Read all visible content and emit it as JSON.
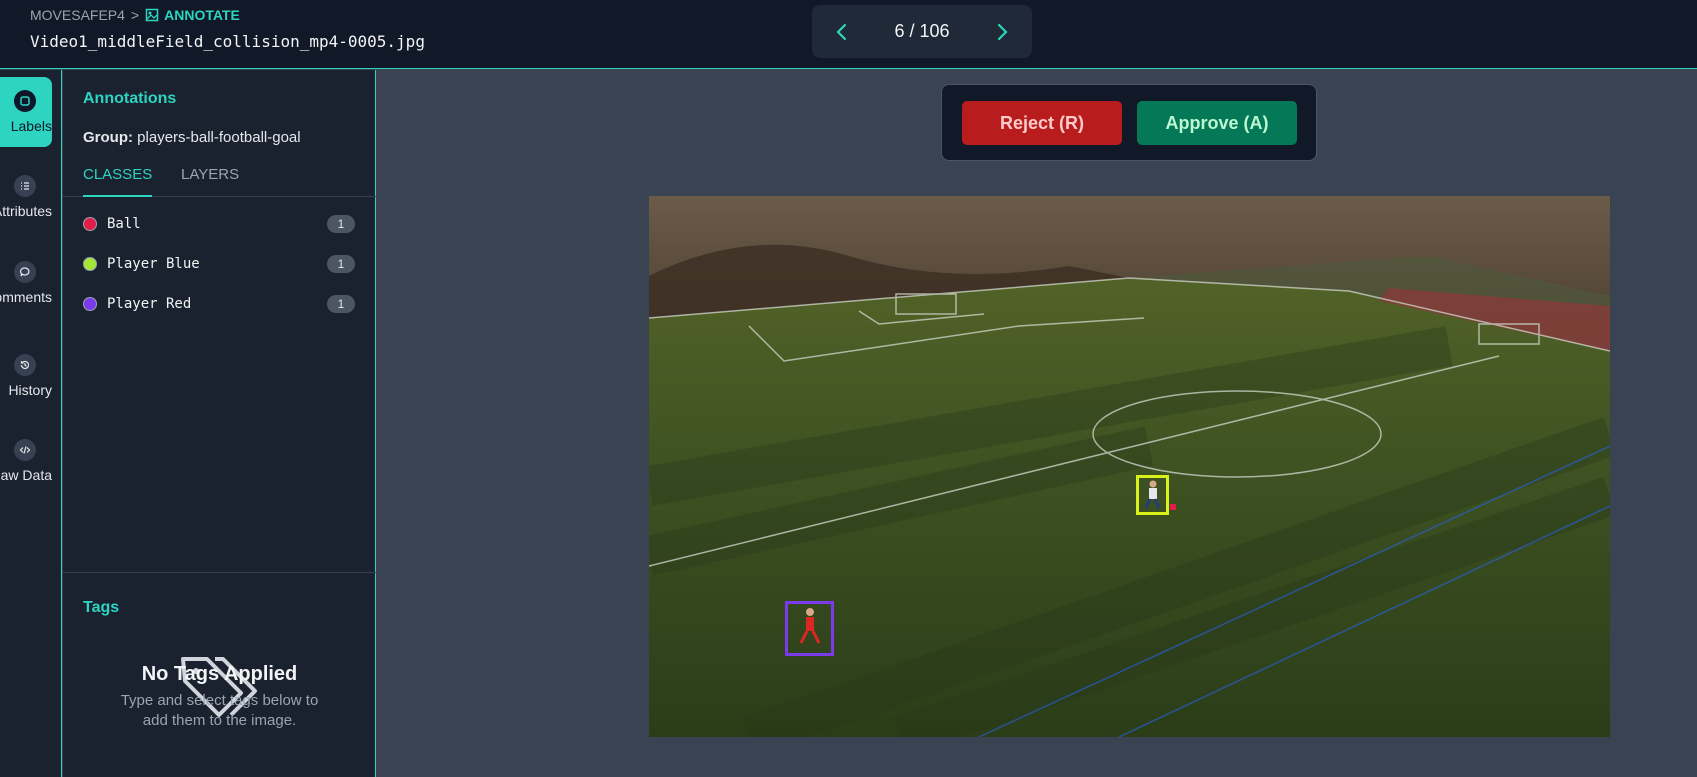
{
  "breadcrumb": {
    "project": "MOVESAFEP4",
    "separator": ">",
    "current": "ANNOTATE"
  },
  "filename": "Video1_middleField_collision_mp4-0005.jpg",
  "pager": {
    "label": "6 / 106"
  },
  "rail": [
    {
      "label": "Labels",
      "icon": "label-icon",
      "active": true
    },
    {
      "label": "Attributes",
      "icon": "list-icon",
      "active": false
    },
    {
      "label": "Comments",
      "icon": "comment-icon",
      "active": false
    },
    {
      "label": "History",
      "icon": "history-icon",
      "active": false
    },
    {
      "label": "Raw Data",
      "icon": "code-icon",
      "active": false
    }
  ],
  "panel": {
    "title": "Annotations",
    "group_label": "Group:",
    "group_value": "players-ball-football-goal",
    "tabs": [
      "CLASSES",
      "LAYERS"
    ],
    "classes": [
      {
        "name": "Ball",
        "count": "1",
        "color": "#e11d48"
      },
      {
        "name": "Player Blue",
        "count": "1",
        "color": "#a3e635"
      },
      {
        "name": "Player Red",
        "count": "1",
        "color": "#7c3aed"
      }
    ]
  },
  "tags": {
    "title": "Tags",
    "empty_title": "No Tags Applied",
    "empty_desc": "Type and select tags below to add them to the image."
  },
  "review": {
    "reject_label": "Reject (R)",
    "approve_label": "Approve (A)"
  },
  "colors": {
    "accent": "#2dd4bf",
    "reject": "#b91c1c",
    "approve": "#047857",
    "ball": "#e11d48",
    "player_blue": "#d9f21a",
    "player_red": "#7c3aed"
  }
}
